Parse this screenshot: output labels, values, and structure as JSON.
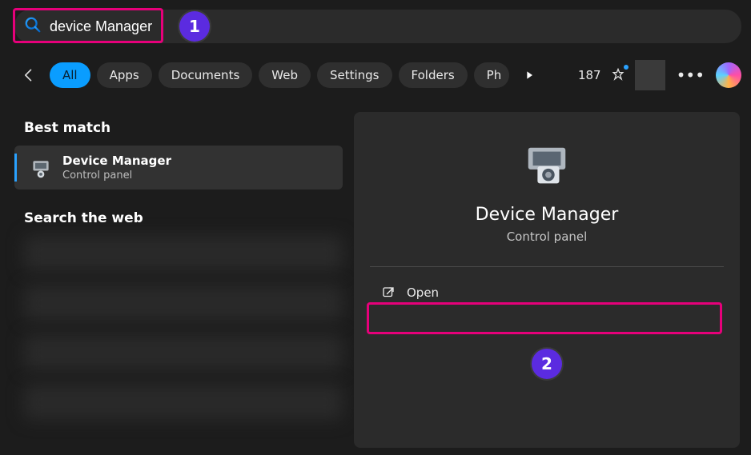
{
  "search": {
    "value": "device Manager"
  },
  "annotations": {
    "step1": "1",
    "step2": "2"
  },
  "filters": {
    "all": "All",
    "apps": "Apps",
    "documents": "Documents",
    "web": "Web",
    "settings": "Settings",
    "folders": "Folders",
    "photos_truncated": "Ph"
  },
  "toolbar": {
    "count": "187"
  },
  "left": {
    "best_match_heading": "Best match",
    "match": {
      "title": "Device Manager",
      "subtitle": "Control panel"
    },
    "web_heading": "Search the web"
  },
  "details": {
    "title": "Device Manager",
    "subtitle": "Control panel",
    "open_label": "Open"
  }
}
